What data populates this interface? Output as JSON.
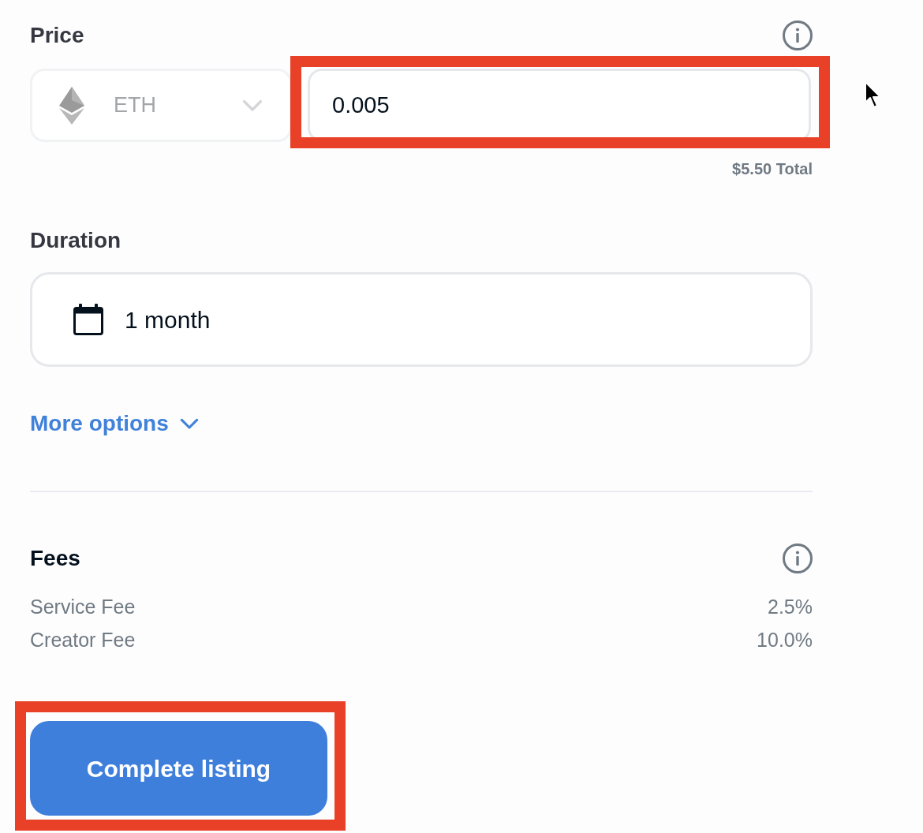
{
  "price": {
    "label": "Price",
    "currency": {
      "symbol": "ETH",
      "disabled": true
    },
    "amount": {
      "value": "0.005",
      "highlighted": true
    },
    "total": "$5.50 Total"
  },
  "duration": {
    "label": "Duration",
    "value": "1 month"
  },
  "more_options": {
    "label": "More options",
    "expanded": false
  },
  "fees": {
    "label": "Fees",
    "items": [
      {
        "name": "Service Fee",
        "value": "2.5%"
      },
      {
        "name": "Creator Fee",
        "value": "10.0%"
      }
    ]
  },
  "submit": {
    "label": "Complete listing",
    "highlighted": true
  }
}
